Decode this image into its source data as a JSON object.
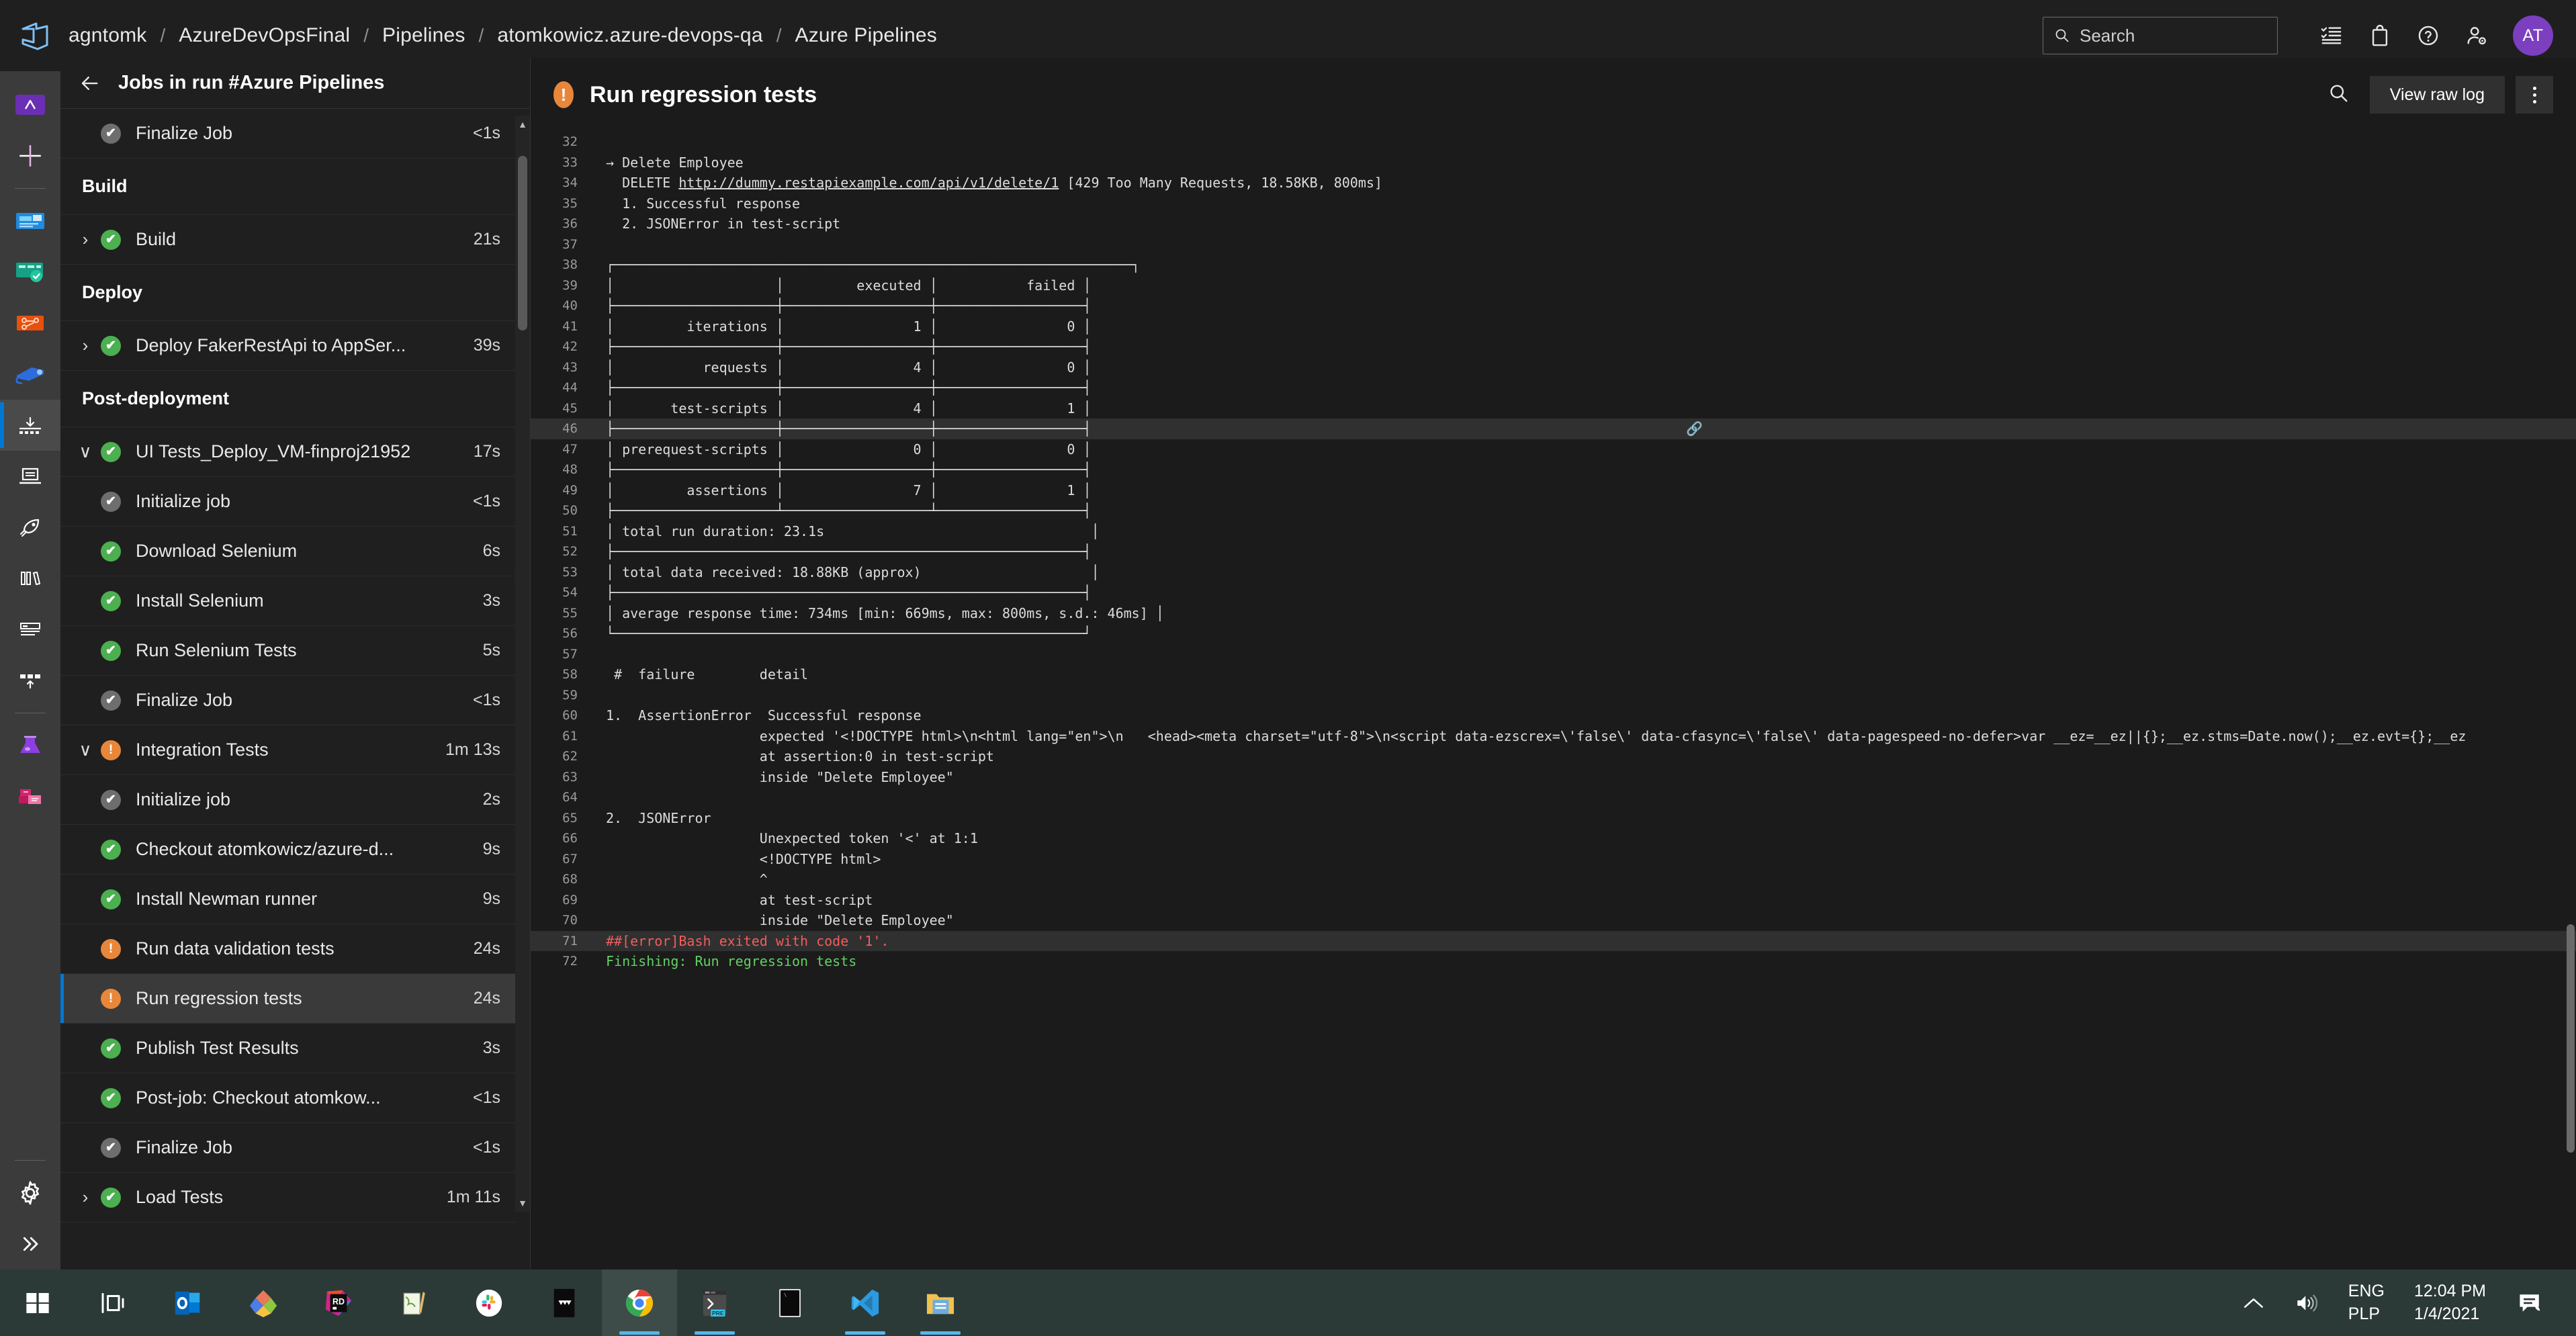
{
  "header": {
    "logo_icon": "azure-devops-logo",
    "breadcrumb": [
      "agntomk",
      "AzureDevOpsFinal",
      "Pipelines",
      "atomkowicz.azure-devops-qa",
      "Azure Pipelines"
    ],
    "separator": "/",
    "search_placeholder": "Search",
    "icons": [
      {
        "name": "checklist-icon",
        "glyph": "≣"
      },
      {
        "name": "shopping-bag-icon",
        "glyph": "▭"
      },
      {
        "name": "help-icon",
        "glyph": "?"
      },
      {
        "name": "user-settings-icon",
        "glyph": "☺"
      }
    ],
    "avatar_initials": "AT"
  },
  "rail": {
    "items": [
      {
        "name": "project-avatar",
        "label": "A",
        "active": false
      },
      {
        "name": "add-new-icon",
        "label": "+",
        "active": false
      },
      {
        "name": "overview-icon",
        "label": "",
        "active": false
      },
      {
        "name": "boards-icon",
        "label": "",
        "active": false
      },
      {
        "name": "repos-icon",
        "label": "",
        "active": false
      },
      {
        "name": "pipelines-icon",
        "label": "",
        "active": false
      },
      {
        "name": "pipelines-runs-icon",
        "label": "",
        "active": true
      },
      {
        "name": "environments-icon",
        "label": "",
        "active": false
      },
      {
        "name": "releases-icon",
        "label": "",
        "active": false
      },
      {
        "name": "library-icon",
        "label": "",
        "active": false
      },
      {
        "name": "task-groups-icon",
        "label": "",
        "active": false
      },
      {
        "name": "deployment-groups-icon",
        "label": "",
        "active": false
      },
      {
        "name": "test-plans-icon",
        "label": "",
        "active": false
      },
      {
        "name": "artifacts-icon",
        "label": "",
        "active": false
      }
    ],
    "settings_label": "gear-icon",
    "expand_label": "chevron-double-right-icon"
  },
  "sidebar": {
    "back_icon": "back-arrow-icon",
    "title": "Jobs in run #Azure Pipelines",
    "rows": [
      {
        "type": "job",
        "indent": 1,
        "status": "skip",
        "label": "Finalize Job",
        "time": "<1s",
        "chevron": "",
        "selected": false
      },
      {
        "type": "section",
        "label": "Build"
      },
      {
        "type": "job",
        "indent": 0,
        "status": "ok",
        "label": "Build",
        "time": "21s",
        "chevron": "›",
        "selected": false
      },
      {
        "type": "section",
        "label": "Deploy"
      },
      {
        "type": "job",
        "indent": 0,
        "status": "ok",
        "label": "Deploy FakerRestApi to AppSer...",
        "time": "39s",
        "chevron": "›",
        "selected": false
      },
      {
        "type": "section",
        "label": "Post-deployment"
      },
      {
        "type": "job",
        "indent": 0,
        "status": "ok",
        "label": "UI Tests_Deploy_VM-finproj21952",
        "time": "17s",
        "chevron": "∨",
        "selected": false
      },
      {
        "type": "job",
        "indent": 1,
        "status": "skip",
        "label": "Initialize job",
        "time": "<1s",
        "chevron": "",
        "selected": false
      },
      {
        "type": "job",
        "indent": 1,
        "status": "ok",
        "label": "Download Selenium",
        "time": "6s",
        "chevron": "",
        "selected": false
      },
      {
        "type": "job",
        "indent": 1,
        "status": "ok",
        "label": "Install Selenium",
        "time": "3s",
        "chevron": "",
        "selected": false
      },
      {
        "type": "job",
        "indent": 1,
        "status": "ok",
        "label": "Run Selenium Tests",
        "time": "5s",
        "chevron": "",
        "selected": false
      },
      {
        "type": "job",
        "indent": 1,
        "status": "skip",
        "label": "Finalize Job",
        "time": "<1s",
        "chevron": "",
        "selected": false
      },
      {
        "type": "job",
        "indent": 0,
        "status": "warn",
        "label": "Integration Tests",
        "time": "1m 13s",
        "chevron": "∨",
        "selected": false
      },
      {
        "type": "job",
        "indent": 1,
        "status": "skip",
        "label": "Initialize job",
        "time": "2s",
        "chevron": "",
        "selected": false
      },
      {
        "type": "job",
        "indent": 1,
        "status": "ok",
        "label": "Checkout atomkowicz/azure-d...",
        "time": "9s",
        "chevron": "",
        "selected": false
      },
      {
        "type": "job",
        "indent": 1,
        "status": "ok",
        "label": "Install Newman runner",
        "time": "9s",
        "chevron": "",
        "selected": false
      },
      {
        "type": "job",
        "indent": 1,
        "status": "warn",
        "label": "Run data validation tests",
        "time": "24s",
        "chevron": "",
        "selected": false
      },
      {
        "type": "job",
        "indent": 1,
        "status": "warn",
        "label": "Run regression tests",
        "time": "24s",
        "chevron": "",
        "selected": true
      },
      {
        "type": "job",
        "indent": 1,
        "status": "ok",
        "label": "Publish Test Results",
        "time": "3s",
        "chevron": "",
        "selected": false
      },
      {
        "type": "job",
        "indent": 1,
        "status": "ok",
        "label": "Post-job: Checkout atomkow...",
        "time": "<1s",
        "chevron": "",
        "selected": false
      },
      {
        "type": "job",
        "indent": 1,
        "status": "skip",
        "label": "Finalize Job",
        "time": "<1s",
        "chevron": "",
        "selected": false
      },
      {
        "type": "job",
        "indent": 0,
        "status": "ok",
        "label": "Load Tests",
        "time": "1m 11s",
        "chevron": "›",
        "selected": false
      }
    ]
  },
  "main": {
    "status_icon": "warning-icon",
    "title": "Run regression tests",
    "search_icon": "search-icon",
    "view_raw_log_label": "View raw log",
    "more_actions_icon": "kebab-menu-icon",
    "log_lines": [
      {
        "n": "32",
        "text": "",
        "style": ""
      },
      {
        "n": "33",
        "text": "→ Delete Employee",
        "style": ""
      },
      {
        "n": "34",
        "text": "  DELETE http://dummy.restapiexample.com/api/v1/delete/1 [429 Too Many Requests, 18.58KB, 800ms]",
        "style": "",
        "link": "http://dummy.restapiexample.com/api/v1/delete/1"
      },
      {
        "n": "35",
        "text": "  1. Successful response",
        "style": ""
      },
      {
        "n": "36",
        "text": "  2. JSONError in test-script",
        "style": ""
      },
      {
        "n": "37",
        "text": "",
        "style": ""
      },
      {
        "n": "38",
        "text": "┌────────────────────────────────────────────────────────────────┐",
        "style": ""
      },
      {
        "n": "39",
        "text": "│                    │         executed │           failed │",
        "style": ""
      },
      {
        "n": "40",
        "text": "├────────────────────┼──────────────────┼──────────────────┤",
        "style": ""
      },
      {
        "n": "41",
        "text": "│         iterations │                1 │                0 │",
        "style": ""
      },
      {
        "n": "42",
        "text": "├────────────────────┼──────────────────┼──────────────────┤",
        "style": ""
      },
      {
        "n": "43",
        "text": "│           requests │                4 │                0 │",
        "style": ""
      },
      {
        "n": "44",
        "text": "├────────────────────┼──────────────────┼──────────────────┤",
        "style": ""
      },
      {
        "n": "45",
        "text": "│       test-scripts │                4 │                1 │",
        "style": ""
      },
      {
        "n": "46",
        "text": "├────────────────────┼──────────────────┼──────────────────┤",
        "style": "hl",
        "link_icon": true
      },
      {
        "n": "47",
        "text": "│ prerequest-scripts │                0 │                0 │",
        "style": ""
      },
      {
        "n": "48",
        "text": "├────────────────────┼──────────────────┼──────────────────┤",
        "style": ""
      },
      {
        "n": "49",
        "text": "│         assertions │                7 │                1 │",
        "style": ""
      },
      {
        "n": "50",
        "text": "├────────────────────┴──────────────────┴──────────────────┤",
        "style": ""
      },
      {
        "n": "51",
        "text": "│ total run duration: 23.1s                                 │",
        "style": ""
      },
      {
        "n": "52",
        "text": "├──────────────────────────────────────────────────────────┤",
        "style": ""
      },
      {
        "n": "53",
        "text": "│ total data received: 18.88KB (approx)                     │",
        "style": ""
      },
      {
        "n": "54",
        "text": "├──────────────────────────────────────────────────────────┤",
        "style": ""
      },
      {
        "n": "55",
        "text": "│ average response time: 734ms [min: 669ms, max: 800ms, s.d.: 46ms] │",
        "style": ""
      },
      {
        "n": "56",
        "text": "└──────────────────────────────────────────────────────────┘",
        "style": ""
      },
      {
        "n": "57",
        "text": "",
        "style": ""
      },
      {
        "n": "58",
        "text": " #  failure        detail",
        "style": ""
      },
      {
        "n": "59",
        "text": "",
        "style": ""
      },
      {
        "n": "60",
        "text": "1.  AssertionError  Successful response",
        "style": ""
      },
      {
        "n": "61",
        "text": "                   expected '<!DOCTYPE html>\\n<html lang=\"en\">\\n   <head><meta charset=\"utf-8\">\\n<script data-ezscrex=\\'false\\' data-cfasync=\\'false\\' data-pagespeed-no-defer>var __ez=__ez||{};__ez.stms=Date.now();__ez.evt={};__ez",
        "style": ""
      },
      {
        "n": "62",
        "text": "                   at assertion:0 in test-script",
        "style": ""
      },
      {
        "n": "63",
        "text": "                   inside \"Delete Employee\"",
        "style": ""
      },
      {
        "n": "64",
        "text": "",
        "style": ""
      },
      {
        "n": "65",
        "text": "2.  JSONError",
        "style": ""
      },
      {
        "n": "66",
        "text": "                   Unexpected token '<' at 1:1",
        "style": ""
      },
      {
        "n": "67",
        "text": "                   <!DOCTYPE html>",
        "style": ""
      },
      {
        "n": "68",
        "text": "                   ^",
        "style": ""
      },
      {
        "n": "69",
        "text": "                   at test-script",
        "style": ""
      },
      {
        "n": "70",
        "text": "                   inside \"Delete Employee\"",
        "style": ""
      },
      {
        "n": "71",
        "text": "##[error]Bash exited with code '1'.",
        "style": "err hl"
      },
      {
        "n": "72",
        "text": "Finishing: Run regression tests",
        "style": "ok"
      }
    ]
  },
  "taskbar": {
    "items": [
      {
        "name": "start-button-icon",
        "running": false,
        "active": false
      },
      {
        "name": "task-view-icon",
        "running": false,
        "active": false
      },
      {
        "name": "outlook-icon",
        "running": false,
        "active": false
      },
      {
        "name": "azure-data-studio-icon",
        "running": false,
        "active": false
      },
      {
        "name": "rider-icon",
        "running": false,
        "active": false
      },
      {
        "name": "notepad-icon",
        "running": false,
        "active": false
      },
      {
        "name": "slack-icon",
        "running": false,
        "active": false
      },
      {
        "name": "postman-icon",
        "running": false,
        "active": false
      },
      {
        "name": "chrome-icon",
        "running": true,
        "active": true
      },
      {
        "name": "terminal-preview-icon",
        "running": true,
        "active": false
      },
      {
        "name": "console-icon",
        "running": false,
        "active": false
      },
      {
        "name": "visual-studio-icon",
        "running": true,
        "active": false
      },
      {
        "name": "file-explorer-icon",
        "running": true,
        "active": false
      }
    ],
    "tray": {
      "show_hidden_icon": "chevron-up-icon",
      "volume_icon": "speaker-icon",
      "lang_primary": "ENG",
      "lang_secondary": "PLP",
      "time": "12:04 PM",
      "date": "1/4/2021",
      "action_center_icon": "notifications-icon"
    }
  },
  "colors": {
    "accent": "#0078d4",
    "success": "#4caf50",
    "warning": "#e8873a",
    "error": "#f25c5c",
    "avatar": "#7b3fbf"
  }
}
